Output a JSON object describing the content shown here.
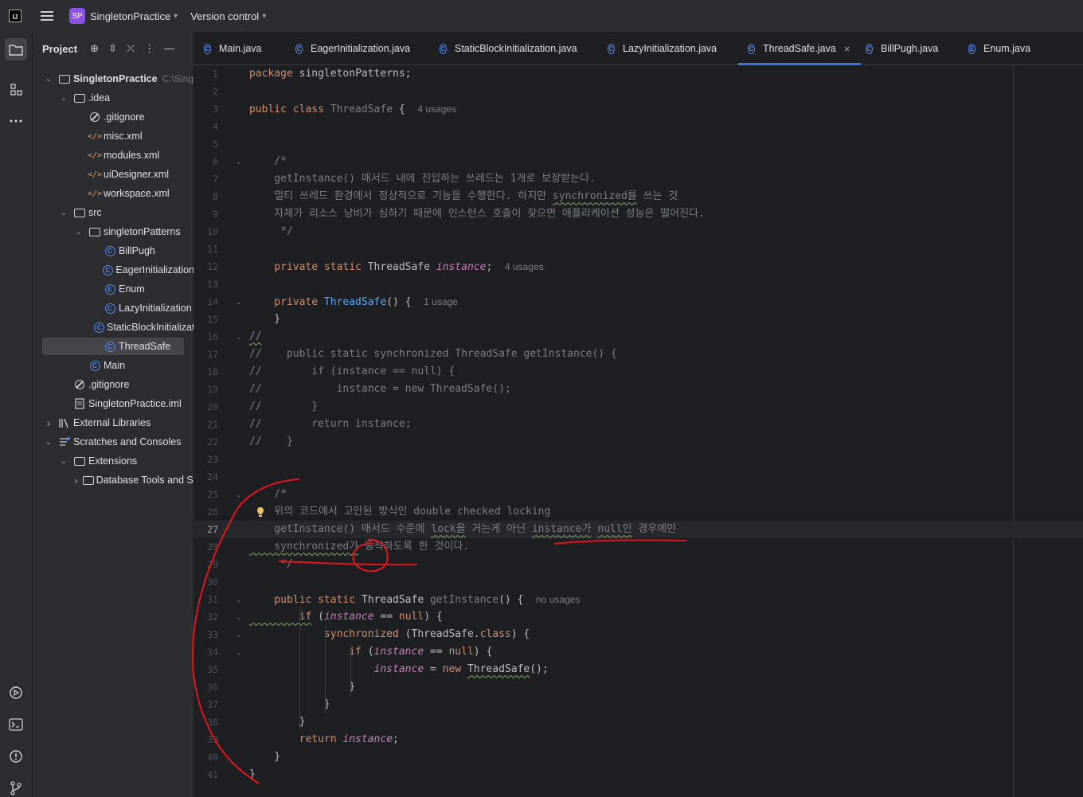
{
  "titlebar": {
    "logo_text": "IJ",
    "project_initials": "SP",
    "project_name": "SingletonPractice",
    "vcs_label": "Version control"
  },
  "toolstrip": {
    "icons": [
      "folder-icon",
      "structure-icon",
      "more-icon",
      "run-icon",
      "terminal-icon",
      "problems-icon",
      "git-icon"
    ]
  },
  "project_panel": {
    "title": "Project",
    "rows": [
      {
        "label": "SingletonPractice",
        "extra": "C:\\Sing",
        "icon": "module-icon",
        "chev": "v",
        "indent": 0,
        "bold": true
      },
      {
        "label": ".idea",
        "icon": "folder-icon",
        "chev": "v",
        "indent": 1
      },
      {
        "label": ".gitignore",
        "icon": "ignore-icon",
        "chev": "",
        "indent": 2
      },
      {
        "label": "misc.xml",
        "icon": "xml-icon",
        "chev": "",
        "indent": 2
      },
      {
        "label": "modules.xml",
        "icon": "xml-icon",
        "chev": "",
        "indent": 2
      },
      {
        "label": "uiDesigner.xml",
        "icon": "xml-icon",
        "chev": "",
        "indent": 2
      },
      {
        "label": "workspace.xml",
        "icon": "xml-icon",
        "chev": "",
        "indent": 2
      },
      {
        "label": "src",
        "icon": "folder-icon",
        "chev": "v",
        "indent": 1
      },
      {
        "label": "singletonPatterns",
        "icon": "package-icon",
        "chev": "v",
        "indent": 2
      },
      {
        "label": "BillPugh",
        "icon": "class-icon",
        "chev": "",
        "indent": 3
      },
      {
        "label": "EagerInitialization",
        "icon": "class-icon",
        "chev": "",
        "indent": 3
      },
      {
        "label": "Enum",
        "icon": "enum-icon",
        "chev": "",
        "indent": 3
      },
      {
        "label": "LazyInitialization",
        "icon": "class-icon",
        "chev": "",
        "indent": 3
      },
      {
        "label": "StaticBlockInitialization",
        "icon": "class-icon",
        "chev": "",
        "indent": 3
      },
      {
        "label": "ThreadSafe",
        "icon": "class-icon",
        "chev": "",
        "indent": 3,
        "selected": true
      },
      {
        "label": "Main",
        "icon": "main-class-icon",
        "chev": "",
        "indent": 2
      },
      {
        "label": ".gitignore",
        "icon": "ignore-icon",
        "chev": "",
        "indent": 1
      },
      {
        "label": "SingletonPractice.iml",
        "icon": "iml-icon",
        "chev": "",
        "indent": 1
      },
      {
        "label": "External Libraries",
        "icon": "library-icon",
        "chev": ">",
        "indent": 0
      },
      {
        "label": "Scratches and Consoles",
        "icon": "scratches-icon",
        "chev": "v",
        "indent": 0
      },
      {
        "label": "Extensions",
        "icon": "folder-icon",
        "chev": "v",
        "indent": 1
      },
      {
        "label": "Database Tools and SQL",
        "icon": "folder-icon",
        "chev": ">",
        "indent": 2
      }
    ]
  },
  "tabs": [
    {
      "label": "Main.java",
      "icon": "main-class-icon"
    },
    {
      "label": "EagerInitialization.java",
      "icon": "class-icon"
    },
    {
      "label": "StaticBlockInitialization.java",
      "icon": "class-icon"
    },
    {
      "label": "LazyInitialization.java",
      "icon": "class-icon"
    },
    {
      "label": "ThreadSafe.java",
      "icon": "class-icon",
      "active": true
    },
    {
      "label": "BillPugh.java",
      "icon": "class-icon"
    },
    {
      "label": "Enum.java",
      "icon": "enum-icon"
    }
  ],
  "editor": {
    "current_line": 27,
    "lines": [
      [
        [
          "kw",
          "package "
        ],
        [
          "",
          "singletonPatterns;"
        ]
      ],
      [],
      [
        [
          "kw",
          "public class "
        ],
        [
          "unused",
          "ThreadSafe"
        ],
        [
          "",
          " {  "
        ],
        [
          "hint",
          "4 usages"
        ]
      ],
      [],
      [],
      [
        [
          "cmt",
          "    /*"
        ]
      ],
      [
        [
          "cmt",
          "    getInstance() 매서드 내에 진입하는 쓰레드는 1개로 보장받는다."
        ]
      ],
      [
        [
          "cmt",
          "    멀티 쓰레드 환경에서 정상적으로 기능을 수행한다. 하지만 "
        ],
        [
          "cmt typo",
          "synchronized를"
        ],
        [
          "cmt",
          " 쓰는 것"
        ]
      ],
      [
        [
          "cmt",
          "    자체가 리소스 낭비가 심하기 때문에 인스턴스 호출이 잦으면 애플리케이션 성능은 떨어진다."
        ]
      ],
      [
        [
          "cmt",
          "     */"
        ]
      ],
      [],
      [
        [
          "kw",
          "    private static "
        ],
        [
          "",
          "ThreadSafe "
        ],
        [
          "field",
          "instance"
        ],
        [
          "",
          ";  "
        ],
        [
          "hint",
          "4 usages"
        ]
      ],
      [],
      [
        [
          "kw",
          "    private "
        ],
        [
          "fn",
          "ThreadSafe"
        ],
        [
          "",
          "() {  "
        ],
        [
          "hint",
          "1 usage"
        ]
      ],
      [
        [
          "",
          "    }"
        ]
      ],
      [
        [
          "cmt typo",
          "//"
        ]
      ],
      [
        [
          "cmt",
          "//    public static synchronized ThreadSafe getInstance() {"
        ]
      ],
      [
        [
          "cmt",
          "//        if (instance == null) {"
        ]
      ],
      [
        [
          "cmt",
          "//            instance = new ThreadSafe();"
        ]
      ],
      [
        [
          "cmt",
          "//        }"
        ]
      ],
      [
        [
          "cmt",
          "//        return instance;"
        ]
      ],
      [
        [
          "cmt",
          "//    }"
        ]
      ],
      [],
      [],
      [
        [
          "cmt",
          "    /*"
        ]
      ],
      [
        [
          "cmt",
          "    위의 코드에서 고안된 방식인 double checked locking"
        ]
      ],
      [
        [
          "cmt",
          "    getInstance() 매서드 수준에 "
        ],
        [
          "cmt typo",
          "lock을"
        ],
        [
          "cmt",
          " 거는게 아닌 "
        ],
        [
          "cmt typo",
          "instance가"
        ],
        [
          "cmt",
          " "
        ],
        [
          "cmt typo",
          "null인"
        ],
        [
          "cmt",
          " 경우에만"
        ]
      ],
      [
        [
          "cmt typo",
          "    synchronized가"
        ],
        [
          "cmt",
          " 동작하도록 한 것이다."
        ]
      ],
      [
        [
          "cmt",
          "     */"
        ]
      ],
      [],
      [
        [
          "kw",
          "    public static "
        ],
        [
          "",
          "ThreadSafe "
        ],
        [
          "unused",
          "getInstance"
        ],
        [
          "",
          "() {  "
        ],
        [
          "hint",
          "no usages"
        ]
      ],
      [
        [
          "kw typo",
          "        if"
        ],
        [
          "",
          " ("
        ],
        [
          "field",
          "instance"
        ],
        [
          "",
          " == "
        ],
        [
          "kw",
          "null"
        ],
        [
          "",
          ") {"
        ]
      ],
      [
        [
          "kw",
          "            synchronized "
        ],
        [
          "",
          "(ThreadSafe."
        ],
        [
          "kw",
          "class"
        ],
        [
          "",
          ") {"
        ]
      ],
      [
        [
          "kw",
          "                if "
        ],
        [
          "",
          "("
        ],
        [
          "field",
          "instance"
        ],
        [
          "",
          " == "
        ],
        [
          "kw",
          "null"
        ],
        [
          "",
          ") {"
        ]
      ],
      [
        [
          "field",
          "                    instance"
        ],
        [
          "",
          " = "
        ],
        [
          "kw",
          "new "
        ],
        [
          "typo",
          "ThreadSafe"
        ],
        [
          "",
          "();"
        ]
      ],
      [
        [
          "",
          "                }"
        ]
      ],
      [
        [
          "",
          "            }"
        ]
      ],
      [
        [
          "",
          "        }"
        ]
      ],
      [
        [
          "kw",
          "        return "
        ],
        [
          "field",
          "instance"
        ],
        [
          "",
          ";"
        ]
      ],
      [
        [
          "",
          "    }"
        ]
      ],
      [
        [
          "",
          "}"
        ]
      ]
    ],
    "fold_lines": [
      6,
      14,
      16,
      25,
      31,
      32,
      33,
      34
    ],
    "bulb_line": 26
  }
}
